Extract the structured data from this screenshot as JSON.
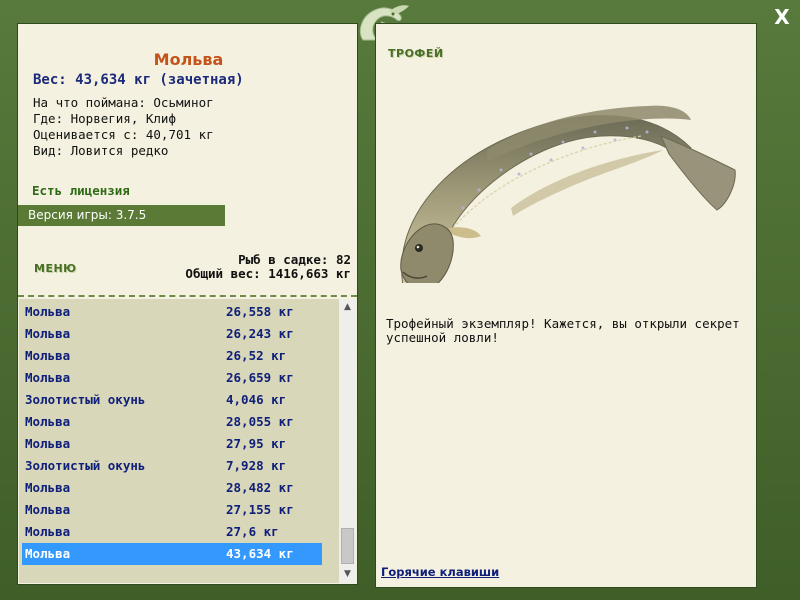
{
  "fish": {
    "name": "Мольва",
    "weight": "Вес: 43,634 кг (зачетная)",
    "info": [
      "На что поймана: Осьминог",
      "Где: Норвегия, Клиф",
      "Оценивается с: 40,701 кг",
      "Вид: Ловится редко"
    ]
  },
  "license": "Есть лицензия",
  "version": "Версия игры: 3.7.5",
  "menu_label": "МЕНЮ",
  "stats": {
    "fish_count": "Рыб в садке: 82",
    "total_weight": "Общий вес: 1416,663 кг"
  },
  "catch_list": [
    {
      "name": "Мольва",
      "weight": "26,558 кг"
    },
    {
      "name": "Мольва",
      "weight": "26,243 кг"
    },
    {
      "name": "Мольва",
      "weight": "26,52 кг"
    },
    {
      "name": "Мольва",
      "weight": "26,659 кг"
    },
    {
      "name": "Золотистый окунь",
      "weight": "4,046 кг"
    },
    {
      "name": "Мольва",
      "weight": "28,055 кг"
    },
    {
      "name": "Мольва",
      "weight": "27,95 кг"
    },
    {
      "name": "Золотистый окунь",
      "weight": "7,928 кг"
    },
    {
      "name": "Мольва",
      "weight": "28,482 кг"
    },
    {
      "name": "Мольва",
      "weight": "27,155 кг"
    },
    {
      "name": "Мольва",
      "weight": "27,6 кг"
    },
    {
      "name": "Мольва",
      "weight": "43,634 кг"
    }
  ],
  "selected_index": 11,
  "trophy": {
    "label": "ТРОФЕЙ",
    "text": "Трофейный экземпляр! Кажется, вы открыли секрет успешной ловли!"
  },
  "hotkeys_link": "Горячие клавиши",
  "close_glyph": "X",
  "scroll_up_glyph": "▲",
  "scroll_down_glyph": "▼",
  "colors": {
    "frame": "#4e6e34",
    "panel": "#f5f1e0",
    "list_bg": "#d9d7b9",
    "selection": "#3399ff",
    "fish_name": "#c4531a",
    "accent_blue": "#10207a"
  }
}
